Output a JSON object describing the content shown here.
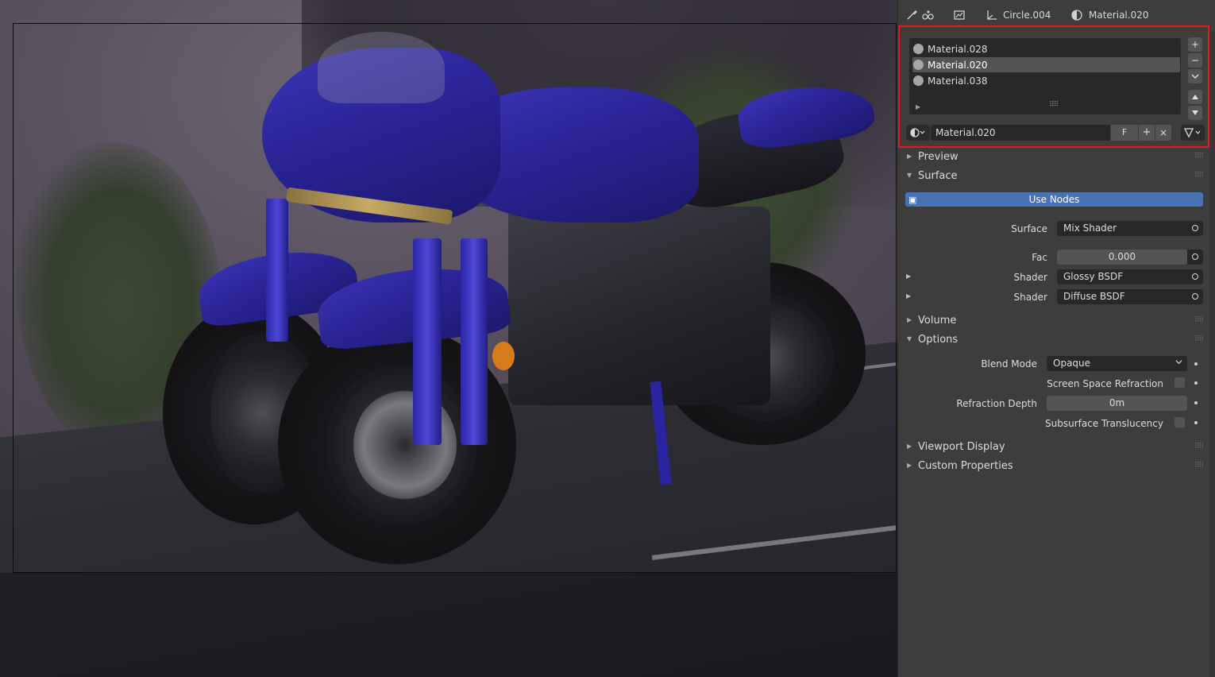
{
  "header": {
    "object_name": "Circle.004",
    "material_name": "Material.020"
  },
  "slots": {
    "items": [
      {
        "label": "Material.028",
        "selected": false
      },
      {
        "label": "Material.020",
        "selected": true
      },
      {
        "label": "Material.038",
        "selected": false
      }
    ]
  },
  "material_selector": {
    "name": "Material.020",
    "fake_user": "F",
    "new_icon": "+",
    "unlink_icon": "×"
  },
  "sections": {
    "preview": "Preview",
    "surface": "Surface",
    "volume": "Volume",
    "options": "Options",
    "viewport_display": "Viewport Display",
    "custom_properties": "Custom Properties"
  },
  "surface": {
    "use_nodes": "Use Nodes",
    "surface_label": "Surface",
    "surface_value": "Mix Shader",
    "fac_label": "Fac",
    "fac_value": "0.000",
    "shader1_label": "Shader",
    "shader1_value": "Glossy BSDF",
    "shader2_label": "Shader",
    "shader2_value": "Diffuse BSDF"
  },
  "options": {
    "blend_mode_label": "Blend Mode",
    "blend_mode_value": "Opaque",
    "ssr_label": "Screen Space Refraction",
    "refraction_depth_label": "Refraction Depth",
    "refraction_depth_value": "0m",
    "subsurface_label": "Subsurface Translucency"
  },
  "colors": {
    "panel_bg": "#3d3d3d",
    "accent_blue": "#4772b3",
    "highlight_red": "#e11b1b"
  },
  "icons": [
    "tool-icon",
    "particles-icon",
    "render-icon",
    "object-data-icon",
    "material-icon",
    "add-icon",
    "remove-icon",
    "chevron-down-icon",
    "move-up-icon",
    "move-down-icon",
    "node-tree-icon"
  ]
}
